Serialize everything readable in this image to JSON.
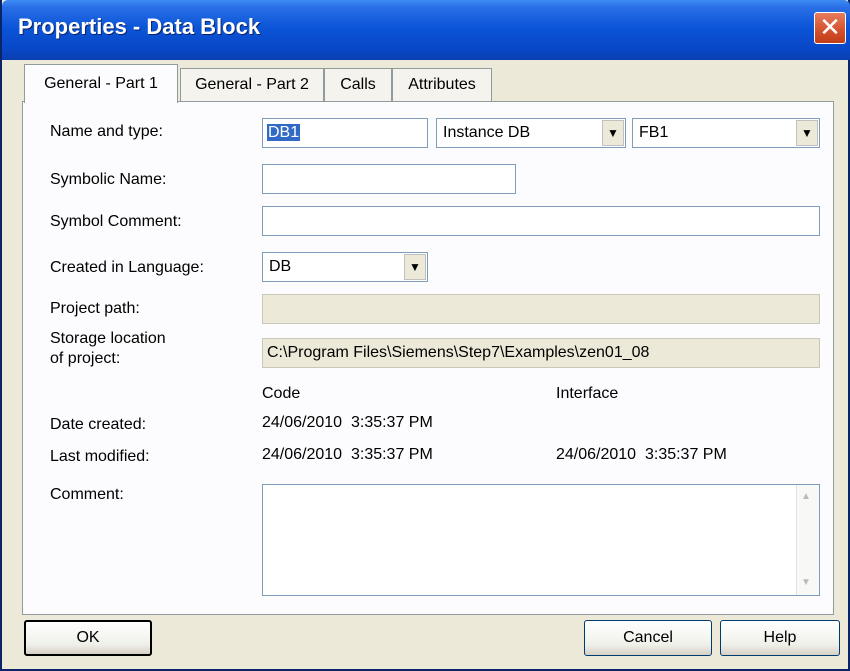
{
  "window": {
    "title": "Properties - Data Block",
    "close_symbol": "✕"
  },
  "tabs": [
    {
      "label": "General - Part 1"
    },
    {
      "label": "General - Part 2"
    },
    {
      "label": "Calls"
    },
    {
      "label": "Attributes"
    }
  ],
  "form": {
    "name_type_label": "Name and type:",
    "name_value": "DB1",
    "type_value": "Instance DB",
    "fb_value": "FB1",
    "symbolic_name_label": "Symbolic Name:",
    "symbolic_name_value": "",
    "symbol_comment_label": "Symbol Comment:",
    "symbol_comment_value": "",
    "created_language_label": "Created in Language:",
    "created_language_value": "DB",
    "project_path_label": "Project path:",
    "project_path_value": "",
    "storage_location_label_line1": "Storage location",
    "storage_location_label_line2": "of project:",
    "storage_location_value": "C:\\Program Files\\Siemens\\Step7\\Examples\\zen01_08",
    "code_header": "Code",
    "interface_header": "Interface",
    "date_created_label": "Date created:",
    "date_created_code": "24/06/2010  3:35:37 PM",
    "last_modified_label": "Last modified:",
    "last_modified_code": "24/06/2010  3:35:37 PM",
    "last_modified_interface": "24/06/2010  3:35:37 PM",
    "comment_label": "Comment:",
    "comment_value": ""
  },
  "buttons": {
    "ok": "OK",
    "cancel": "Cancel",
    "help": "Help"
  },
  "icons": {
    "dropdown": "chevron-down-icon",
    "close": "close-icon",
    "scroll_up": "scroll-up-icon",
    "scroll_down": "scroll-down-icon"
  }
}
